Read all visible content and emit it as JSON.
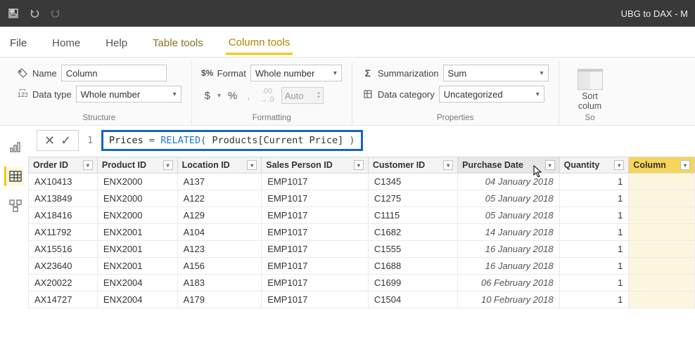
{
  "titlebar": {
    "title": "UBG to DAX - M"
  },
  "menu": {
    "file": "File",
    "home": "Home",
    "help": "Help",
    "table_tools": "Table tools",
    "column_tools": "Column tools"
  },
  "ribbon": {
    "structure": {
      "name_label": "Name",
      "name_value": "Column",
      "datatype_label": "Data type",
      "datatype_value": "Whole number",
      "group_label": "Structure"
    },
    "formatting": {
      "format_label": "Format",
      "format_value": "Whole number",
      "dollar": "$",
      "percent": "%",
      "comma": ",",
      "decimals_inc": ".00",
      "decimals_dec": "→.0",
      "auto": "Auto",
      "group_label": "Formatting"
    },
    "properties": {
      "summarization_label": "Summarization",
      "summarization_value": "Sum",
      "datacategory_label": "Data category",
      "datacategory_value": "Uncategorized",
      "group_label": "Properties"
    },
    "sort": {
      "label1": "Sort",
      "label2": "colum",
      "group_label": "So"
    }
  },
  "formula": {
    "line_no": "1",
    "name": "Prices",
    "eq": " = ",
    "fn": "RELATED",
    "open": "( ",
    "arg": "Products[Current Price]",
    "close": " )"
  },
  "table": {
    "headers": [
      "Order ID",
      "Product ID",
      "Location ID",
      "Sales Person ID",
      "Customer ID",
      "Purchase Date",
      "Quantity",
      "Column"
    ],
    "rows": [
      [
        "AX10413",
        "ENX2000",
        "A137",
        "EMP1017",
        "C1345",
        "04 January 2018",
        "1",
        ""
      ],
      [
        "AX13849",
        "ENX2000",
        "A122",
        "EMP1017",
        "C1275",
        "05 January 2018",
        "1",
        ""
      ],
      [
        "AX18416",
        "ENX2000",
        "A129",
        "EMP1017",
        "C1115",
        "05 January 2018",
        "1",
        ""
      ],
      [
        "AX11792",
        "ENX2001",
        "A104",
        "EMP1017",
        "C1682",
        "14 January 2018",
        "1",
        ""
      ],
      [
        "AX15516",
        "ENX2001",
        "A123",
        "EMP1017",
        "C1555",
        "16 January 2018",
        "1",
        ""
      ],
      [
        "AX23640",
        "ENX2001",
        "A156",
        "EMP1017",
        "C1688",
        "16 January 2018",
        "1",
        ""
      ],
      [
        "AX20022",
        "ENX2004",
        "A183",
        "EMP1017",
        "C1699",
        "06 February 2018",
        "1",
        ""
      ],
      [
        "AX14727",
        "ENX2004",
        "A179",
        "EMP1017",
        "C1504",
        "10 February 2018",
        "1",
        ""
      ]
    ]
  }
}
